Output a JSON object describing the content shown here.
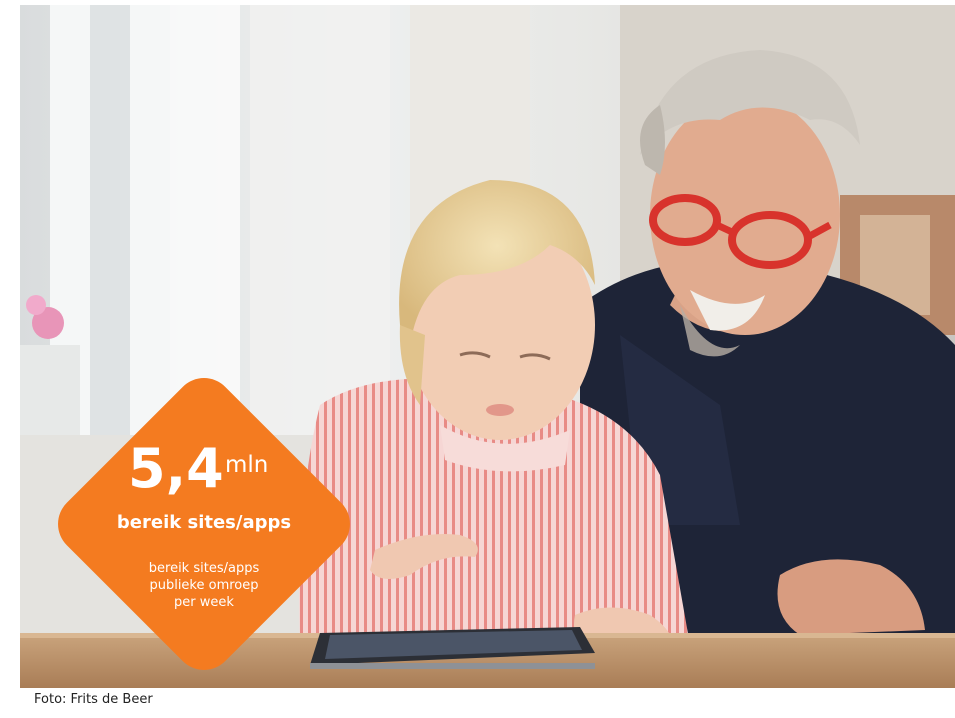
{
  "photo": {
    "icon": "photograph-grandfather-and-child-with-tablet"
  },
  "badge": {
    "color": "#f47b20",
    "number": "5,4",
    "unit": "mln",
    "headline": "bereik sites/apps",
    "description_lines": [
      "bereik sites/apps",
      "publieke omroep",
      "per week"
    ]
  },
  "credit": "Foto: Frits de Beer"
}
